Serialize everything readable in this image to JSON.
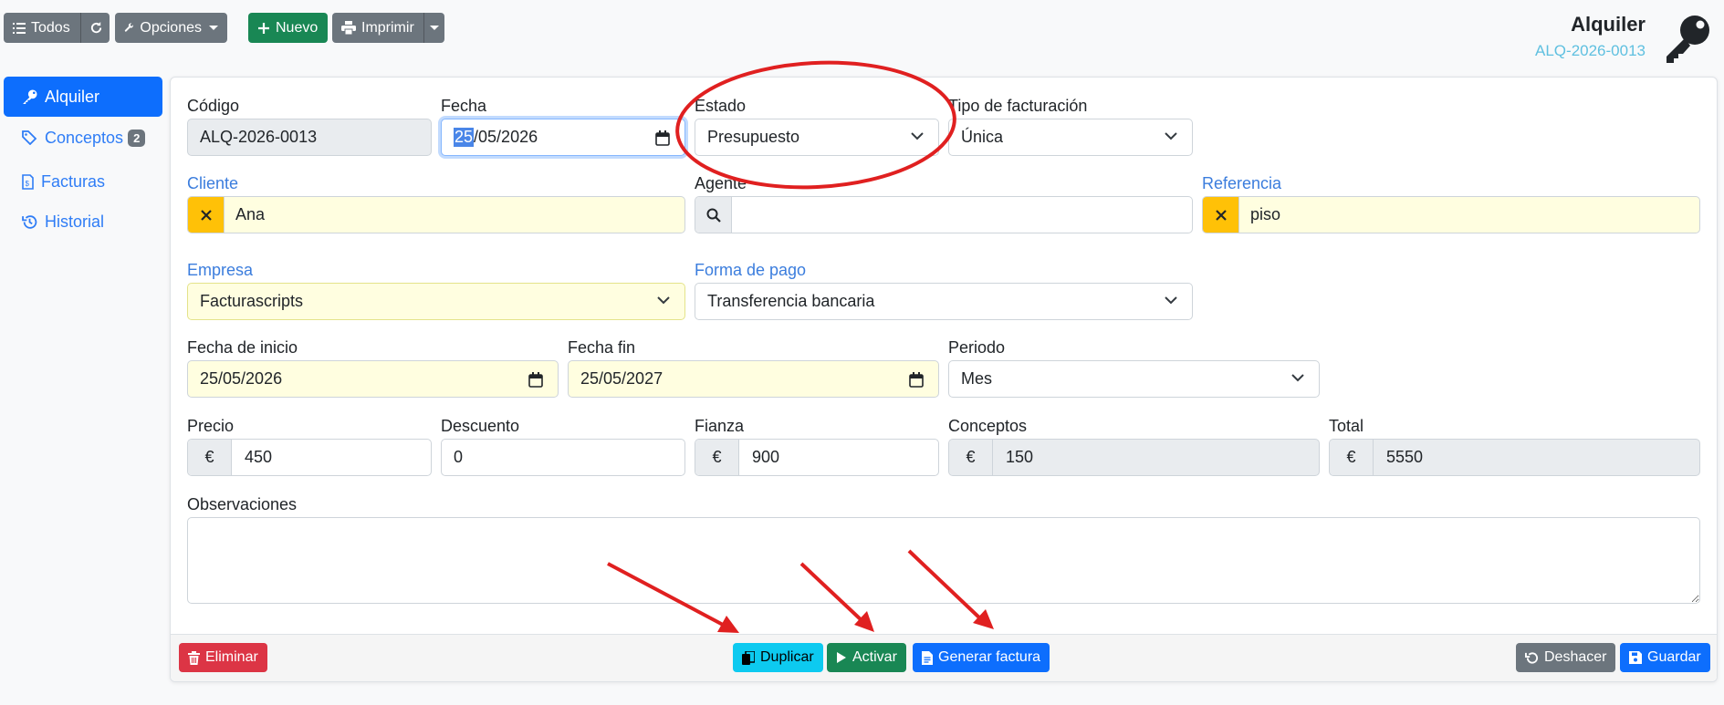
{
  "toolbar": {
    "all_label": "Todos",
    "options_label": "Opciones",
    "new_label": "Nuevo",
    "print_label": "Imprimir"
  },
  "header": {
    "title": "Alquiler",
    "code": "ALQ-2026-0013"
  },
  "sidebar": {
    "items": [
      {
        "label": "Alquiler",
        "icon": "key-icon",
        "active": true
      },
      {
        "label": "Conceptos",
        "icon": "tags-icon",
        "badge": "2"
      },
      {
        "label": "Facturas",
        "icon": "invoice-icon"
      },
      {
        "label": "Historial",
        "icon": "history-icon"
      }
    ]
  },
  "form": {
    "codigo": {
      "label": "Código",
      "value": "ALQ-2026-0013"
    },
    "fecha": {
      "label": "Fecha",
      "value_selected": "25",
      "value_rest": "/05/2026"
    },
    "estado": {
      "label": "Estado",
      "value": "Presupuesto"
    },
    "tipo_facturacion": {
      "label": "Tipo de facturación",
      "value": "Única"
    },
    "cliente": {
      "label": "Cliente",
      "value": "Ana"
    },
    "agente": {
      "label": "Agente",
      "value": ""
    },
    "referencia": {
      "label": "Referencia",
      "value": "piso"
    },
    "empresa": {
      "label": "Empresa",
      "value": "Facturascripts"
    },
    "forma_pago": {
      "label": "Forma de pago",
      "value": "Transferencia bancaria"
    },
    "fecha_inicio": {
      "label": "Fecha de inicio",
      "value": "25/05/2026"
    },
    "fecha_fin": {
      "label": "Fecha fin",
      "value": "25/05/2027"
    },
    "periodo": {
      "label": "Periodo",
      "value": "Mes"
    },
    "precio": {
      "label": "Precio",
      "currency": "€",
      "value": "450"
    },
    "descuento": {
      "label": "Descuento",
      "value": "0"
    },
    "fianza": {
      "label": "Fianza",
      "currency": "€",
      "value": "900"
    },
    "conceptos": {
      "label": "Conceptos",
      "currency": "€",
      "value": "150"
    },
    "total": {
      "label": "Total",
      "currency": "€",
      "value": "5550"
    },
    "observaciones": {
      "label": "Observaciones",
      "value": ""
    }
  },
  "footer": {
    "delete_label": "Eliminar",
    "duplicate_label": "Duplicar",
    "activate_label": "Activar",
    "invoice_label": "Generar factura",
    "undo_label": "Deshacer",
    "save_label": "Guardar"
  },
  "colors": {
    "primary": "#0d6efd",
    "success": "#198754",
    "danger": "#dc3545",
    "info": "#0dcaf0",
    "secondary": "#6c757d",
    "warning": "#ffc107",
    "annotation": "#e02020"
  }
}
